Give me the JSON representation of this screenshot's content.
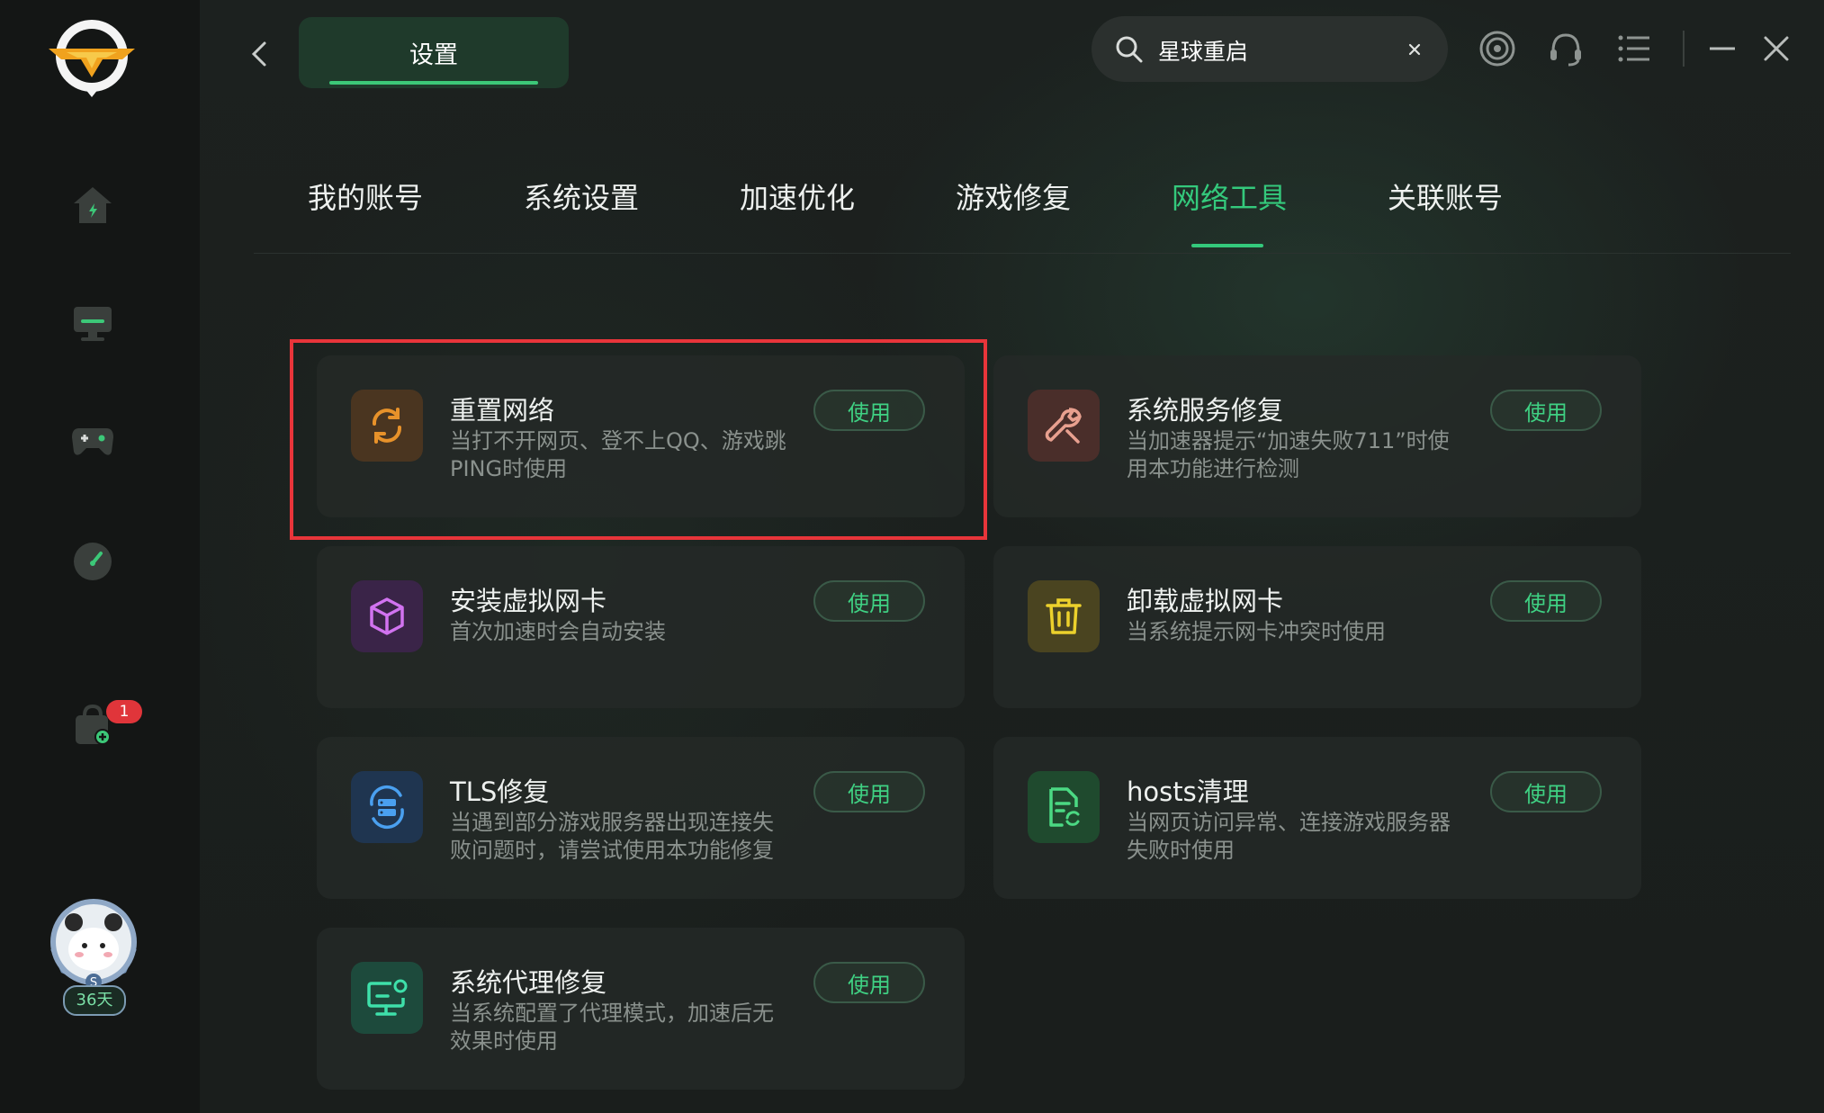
{
  "window": {
    "title_tab": "设置",
    "search_value": "星球重启"
  },
  "sidebar": {
    "items": [
      {
        "name": "home"
      },
      {
        "name": "monitor"
      },
      {
        "name": "gamepad"
      },
      {
        "name": "speedometer"
      },
      {
        "name": "bag"
      }
    ],
    "badge_count": "1",
    "avatar_days": "36天"
  },
  "tabs": [
    {
      "label": "我的账号",
      "active": false
    },
    {
      "label": "系统设置",
      "active": false
    },
    {
      "label": "加速优化",
      "active": false
    },
    {
      "label": "游戏修复",
      "active": false
    },
    {
      "label": "网络工具",
      "active": true
    },
    {
      "label": "关联账号",
      "active": false
    }
  ],
  "tools": [
    {
      "name": "重置网络",
      "desc": "当打不开网页、登不上QQ、游戏跳PING时使用",
      "button": "使用",
      "icon": "refresh-icon",
      "color": "#c97a1f",
      "bg": "#4a3520"
    },
    {
      "name": "系统服务修复",
      "desc": "当加速器提示“加速失败711”时使用本功能进行检测",
      "button": "使用",
      "icon": "wrench-icon",
      "color": "#d98a7a",
      "bg": "#4a2e2a"
    },
    {
      "name": "安装虚拟网卡",
      "desc": "首次加速时会自动安装",
      "button": "使用",
      "icon": "cube-icon",
      "color": "#c865e8",
      "bg": "#3a2448"
    },
    {
      "name": "卸载虚拟网卡",
      "desc": "当系统提示网卡冲突时使用",
      "button": "使用",
      "icon": "trash-icon",
      "color": "#e3c52a",
      "bg": "#4a4420"
    },
    {
      "name": "TLS修复",
      "desc": "当遇到部分游戏服务器出现连接失败问题时，请尝试使用本功能修复",
      "button": "使用",
      "icon": "server-refresh-icon",
      "color": "#3d8ee0",
      "bg": "#1f3550"
    },
    {
      "name": "hosts清理",
      "desc": "当网页访问异常、连接游戏服务器失败时使用",
      "button": "使用",
      "icon": "file-refresh-icon",
      "color": "#3fcf78",
      "bg": "#1f4a2e"
    },
    {
      "name": "系统代理修复",
      "desc": "当系统配置了代理模式，加速后无效果时使用",
      "button": "使用",
      "icon": "monitor-settings-icon",
      "color": "#32d6a0",
      "bg": "#1d4a3c"
    }
  ],
  "colors": {
    "accent": "#34c97c",
    "highlight": "#e8353a",
    "badge": "#e0353a"
  }
}
